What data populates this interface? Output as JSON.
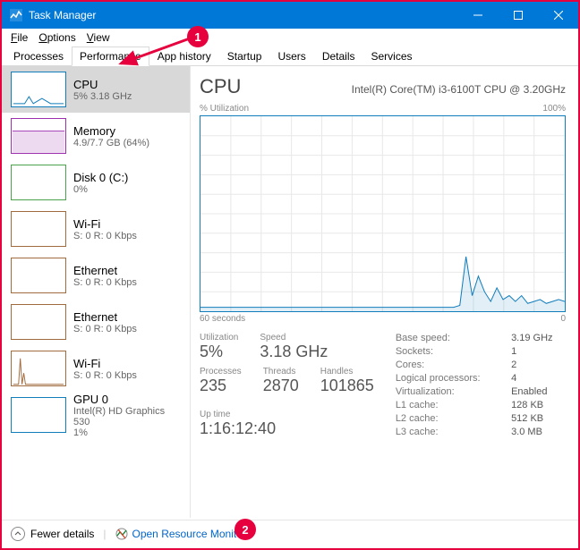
{
  "window": {
    "title": "Task Manager"
  },
  "menu": {
    "file": "File",
    "file_u": "F",
    "options": "Options",
    "options_u": "O",
    "view": "View",
    "view_u": "V"
  },
  "tabs": [
    "Processes",
    "Performance",
    "App history",
    "Startup",
    "Users",
    "Details",
    "Services"
  ],
  "active_tab": 1,
  "sidebar": [
    {
      "name": "CPU",
      "sub": "5% 3.18 GHz",
      "color": "#117dbb"
    },
    {
      "name": "Memory",
      "sub": "4.9/7.7 GB (64%)",
      "color": "#9b2fae"
    },
    {
      "name": "Disk 0 (C:)",
      "sub": "0%",
      "color": "#4ca24c"
    },
    {
      "name": "Wi-Fi",
      "sub": "S: 0 R: 0 Kbps",
      "color": "#a06b3f"
    },
    {
      "name": "Ethernet",
      "sub": "S: 0 R: 0 Kbps",
      "color": "#a06b3f"
    },
    {
      "name": "Ethernet",
      "sub": "S: 0 R: 0 Kbps",
      "color": "#a06b3f"
    },
    {
      "name": "Wi-Fi",
      "sub": "S: 0 R: 0 Kbps",
      "color": "#a06b3f"
    },
    {
      "name": "GPU 0",
      "sub": "Intel(R) HD Graphics 530\n1%",
      "color": "#117dbb"
    }
  ],
  "main": {
    "title": "CPU",
    "cpu_name": "Intel(R) Core(TM) i3-6100T CPU @ 3.20GHz",
    "ylabel": "% Utilization",
    "ymax": "100%",
    "xleft": "60 seconds",
    "xright": "0",
    "stats": {
      "utilization_lbl": "Utilization",
      "utilization": "5%",
      "speed_lbl": "Speed",
      "speed": "3.18 GHz",
      "processes_lbl": "Processes",
      "processes": "235",
      "threads_lbl": "Threads",
      "threads": "2870",
      "handles_lbl": "Handles",
      "handles": "101865",
      "uptime_lbl": "Up time",
      "uptime": "1:16:12:40"
    },
    "right": {
      "base_speed_k": "Base speed:",
      "base_speed_v": "3.19 GHz",
      "sockets_k": "Sockets:",
      "sockets_v": "1",
      "cores_k": "Cores:",
      "cores_v": "2",
      "lp_k": "Logical processors:",
      "lp_v": "4",
      "virt_k": "Virtualization:",
      "virt_v": "Enabled",
      "l1_k": "L1 cache:",
      "l1_v": "128 KB",
      "l2_k": "L2 cache:",
      "l2_v": "512 KB",
      "l3_k": "L3 cache:",
      "l3_v": "3.0 MB"
    }
  },
  "footer": {
    "fewer": "Fewer details",
    "open_rm": "Open Resource Monitor"
  },
  "annotations": {
    "one": "1",
    "two": "2"
  },
  "chart_data": {
    "type": "line",
    "title": "% Utilization",
    "xlabel": "seconds",
    "ylabel": "% Utilization",
    "ylim": [
      0,
      100
    ],
    "xlim": [
      60,
      0
    ],
    "values": [
      2,
      2,
      2,
      2,
      2,
      2,
      2,
      2,
      2,
      2,
      2,
      2,
      2,
      2,
      2,
      2,
      2,
      2,
      2,
      2,
      2,
      2,
      2,
      2,
      2,
      2,
      2,
      2,
      2,
      2,
      2,
      2,
      2,
      2,
      2,
      2,
      2,
      2,
      2,
      2,
      2,
      2,
      3,
      28,
      8,
      18,
      10,
      5,
      12,
      6,
      8,
      5,
      8,
      4,
      5,
      6,
      4,
      5,
      6,
      5
    ]
  }
}
